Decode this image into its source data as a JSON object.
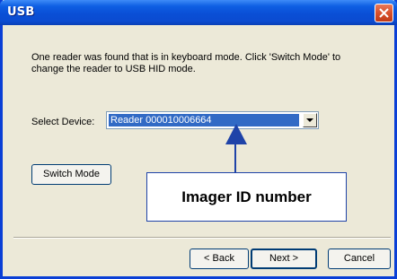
{
  "window": {
    "title": "USB",
    "close_icon": "close-icon"
  },
  "content": {
    "message": "One reader was found that is in keyboard mode. Click 'Switch Mode' to change the reader to USB HID mode.",
    "select_label": "Select Device:",
    "select_value": "Reader 000010006664",
    "switch_mode_label": "Switch Mode"
  },
  "footer": {
    "back_label": "< Back",
    "next_label": "Next >",
    "cancel_label": "Cancel"
  },
  "annotation": {
    "callout_text": "Imager ID number",
    "arrow_color": "#1f43a8"
  },
  "colors": {
    "titlebar": "#0a4fd6",
    "selection": "#316ac5",
    "dialog_bg": "#ece9d8"
  }
}
